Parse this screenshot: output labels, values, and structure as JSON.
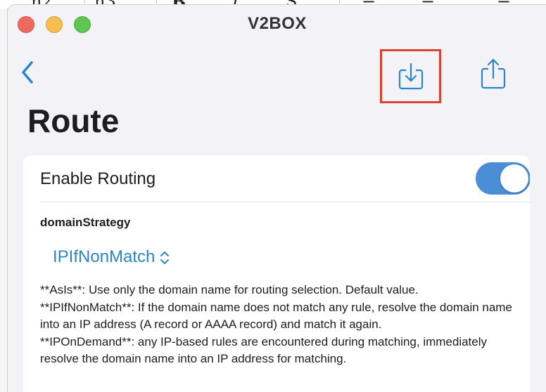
{
  "window": {
    "title": "V2BOX"
  },
  "page": {
    "title": "Route"
  },
  "routing": {
    "enable_label": "Enable Routing",
    "enabled": true
  },
  "domain_strategy": {
    "label": "domainStrategy",
    "selected": "IPIfNonMatch",
    "description": [
      "**AsIs**: Use only the domain name for routing selection. Default value.",
      "**IPIfNonMatch**: If the domain name does not match any rule, resolve the domain name into an IP address (A record or AAAA record) and match it again.",
      "**IPOnDemand**: any IP-based rules are encountered during matching, immediately resolve the domain name into an IP address for matching."
    ]
  },
  "icons": {
    "back": "chevron-left-icon",
    "import": "tray-arrow-down-icon",
    "share": "share-icon",
    "select": "chevron-up-down-icon"
  },
  "colors": {
    "accent": "#2a86c8",
    "toggle_on": "#4a8fd6",
    "highlight_box": "#e0402f",
    "close": "#ed6a5e",
    "minimize": "#f5bf4f",
    "maximize": "#61c554"
  }
}
